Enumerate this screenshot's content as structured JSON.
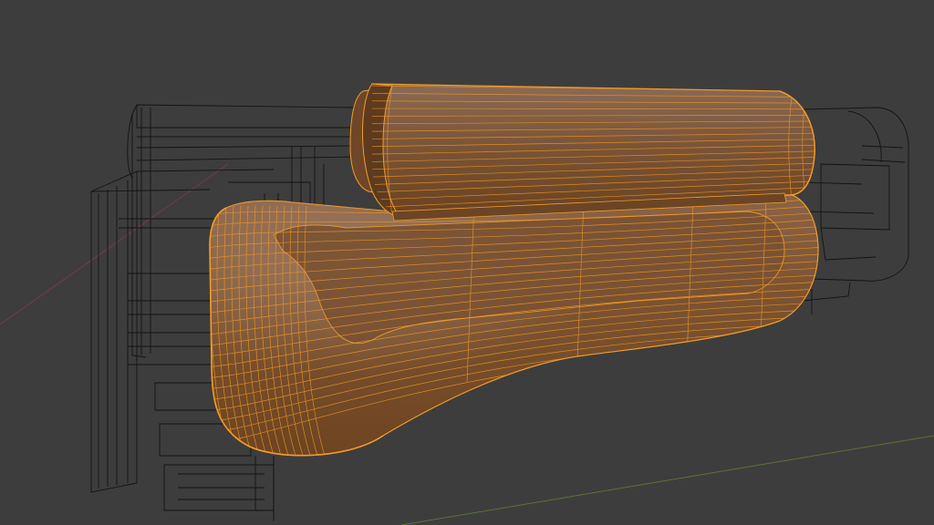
{
  "viewport": {
    "background": "#3d3d3d",
    "wire_color": "#0c0c0c",
    "selected_color": "#f39c26",
    "surface_color": "#8a5a36",
    "axis_x_color": "#8e3b47",
    "axis_y_color": "#6a8a2c"
  },
  "objects": [
    {
      "name": "handguard-lower",
      "selected": true
    },
    {
      "name": "handguard-upper",
      "selected": true
    },
    {
      "name": "rifle-body-wireframe",
      "selected": false
    }
  ]
}
